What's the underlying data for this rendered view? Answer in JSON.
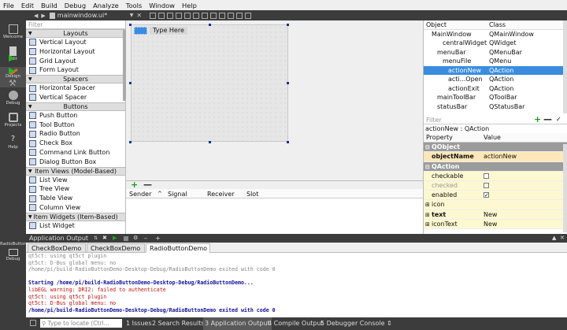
{
  "menu": [
    "File",
    "Edit",
    "Build",
    "Debug",
    "Analyze",
    "Tools",
    "Window",
    "Help"
  ],
  "modes": [
    {
      "label": "Welcome",
      "icon": "welcome-icon"
    },
    {
      "label": "Edit",
      "icon": "edit-icon"
    },
    {
      "label": "Design",
      "icon": "design-icon"
    },
    {
      "label": "Debug",
      "icon": "debug-icon"
    },
    {
      "label": "Projects",
      "icon": "projects-icon"
    },
    {
      "label": "Help",
      "icon": "help-icon"
    }
  ],
  "kit": {
    "project": "RadioButtonDemo",
    "target": "Debug"
  },
  "document": {
    "filename": "mainwindow.ui*"
  },
  "widgetbox": {
    "filter_placeholder": "Filter",
    "layouts": {
      "title": "Layouts",
      "items": [
        "Vertical Layout",
        "Horizontal Layout",
        "Grid Layout",
        "Form Layout"
      ]
    },
    "spacers": {
      "title": "Spacers",
      "items": [
        "Horizontal Spacer",
        "Vertical Spacer"
      ]
    },
    "buttons": {
      "title": "Buttons",
      "items": [
        "Push Button",
        "Tool Button",
        "Radio Button",
        "Check Box",
        "Command Link Button",
        "Dialog Button Box"
      ]
    },
    "itemviews": {
      "title": "Item Views (Model-Based)",
      "items": [
        "List View",
        "Tree View",
        "Table View",
        "Column View"
      ]
    },
    "itemwidgets": {
      "title": "Item Widgets (Item-Based)",
      "items": [
        "List Widget"
      ]
    }
  },
  "form": {
    "menu_placeholder": "Type Here"
  },
  "signals": {
    "headers": [
      "Sender",
      "Signal",
      "Receiver",
      "Slot"
    ]
  },
  "objectinspector": {
    "headers": [
      "Object",
      "Class"
    ],
    "rows": [
      {
        "obj": "MainWindow",
        "cls": "QMainWindow",
        "indent": 0
      },
      {
        "obj": "centralWidget",
        "cls": "QWidget",
        "indent": 2
      },
      {
        "obj": "menuBar",
        "cls": "QMenuBar",
        "indent": 1
      },
      {
        "obj": "menuFile",
        "cls": "QMenu",
        "indent": 2
      },
      {
        "obj": "actionNew",
        "cls": "QAction",
        "indent": 3,
        "selected": true
      },
      {
        "obj": "acti...Open",
        "cls": "QAction",
        "indent": 3
      },
      {
        "obj": "actionExit",
        "cls": "QAction",
        "indent": 3
      },
      {
        "obj": "mainToolBar",
        "cls": "QToolBar",
        "indent": 1
      },
      {
        "obj": "statusBar",
        "cls": "QStatusBar",
        "indent": 1
      }
    ]
  },
  "propertyeditor": {
    "filter_placeholder": "Filter",
    "context": "actionNew : QAction",
    "headers": [
      "Property",
      "Value"
    ],
    "rows": [
      {
        "name": "QObject",
        "value": "",
        "type": "group"
      },
      {
        "name": "objectName",
        "value": "actionNew",
        "type": "o",
        "bold": true
      },
      {
        "name": "QAction",
        "value": "",
        "type": "group"
      },
      {
        "name": "checkable",
        "value": "",
        "type": "y",
        "check": "off"
      },
      {
        "name": "checked",
        "value": "",
        "type": "y",
        "check": "off",
        "disabled": true
      },
      {
        "name": "enabled",
        "value": "",
        "type": "y",
        "check": "on"
      },
      {
        "name": "icon",
        "value": "",
        "type": "y",
        "expand": true
      },
      {
        "name": "text",
        "value": "New",
        "type": "y",
        "expand": true,
        "bold": true
      },
      {
        "name": "iconText",
        "value": "New",
        "type": "y",
        "expand": true
      }
    ]
  },
  "output": {
    "title": "Application Output",
    "tabs": [
      "CheckBoxDemo",
      "CheckBoxDemo",
      "RadioButtonDemo"
    ],
    "lines": [
      {
        "text": "qt5ct: using qt5ct plugin",
        "color": "#888888"
      },
      {
        "text": "qt5ct: D-Bus global menu: no",
        "color": "#888888"
      },
      {
        "text": "/home/pi/build-RadioButtonDemo-Desktop-Debug/RadioButtonDemo exited with code 0",
        "color": "#888888"
      },
      {
        "text": "",
        "color": "#000000"
      },
      {
        "text": "Starting /home/pi/build-RadioButtonDemo-Desktop-Debug/RadioButtonDemo...",
        "color": "#1010a0",
        "bold": true
      },
      {
        "text": "libEGL warning: DRI2: failed to authenticate",
        "color": "#c01010"
      },
      {
        "text": "qt5ct: using qt5ct plugin",
        "color": "#c01010"
      },
      {
        "text": "qt5ct: D-Bus global menu: no",
        "color": "#c01010"
      },
      {
        "text": "/home/pi/build-RadioButtonDemo-Desktop-Debug/RadioButtonDemo exited with code 0",
        "color": "#1010a0",
        "bold": true
      }
    ]
  },
  "statusbar": {
    "locator_placeholder": "Type to locate (Ctrl...",
    "panes": [
      "1 Issues",
      "2 Search Results",
      "3 Application Output",
      "4 Compile Output",
      "5 Debugger Console"
    ]
  }
}
